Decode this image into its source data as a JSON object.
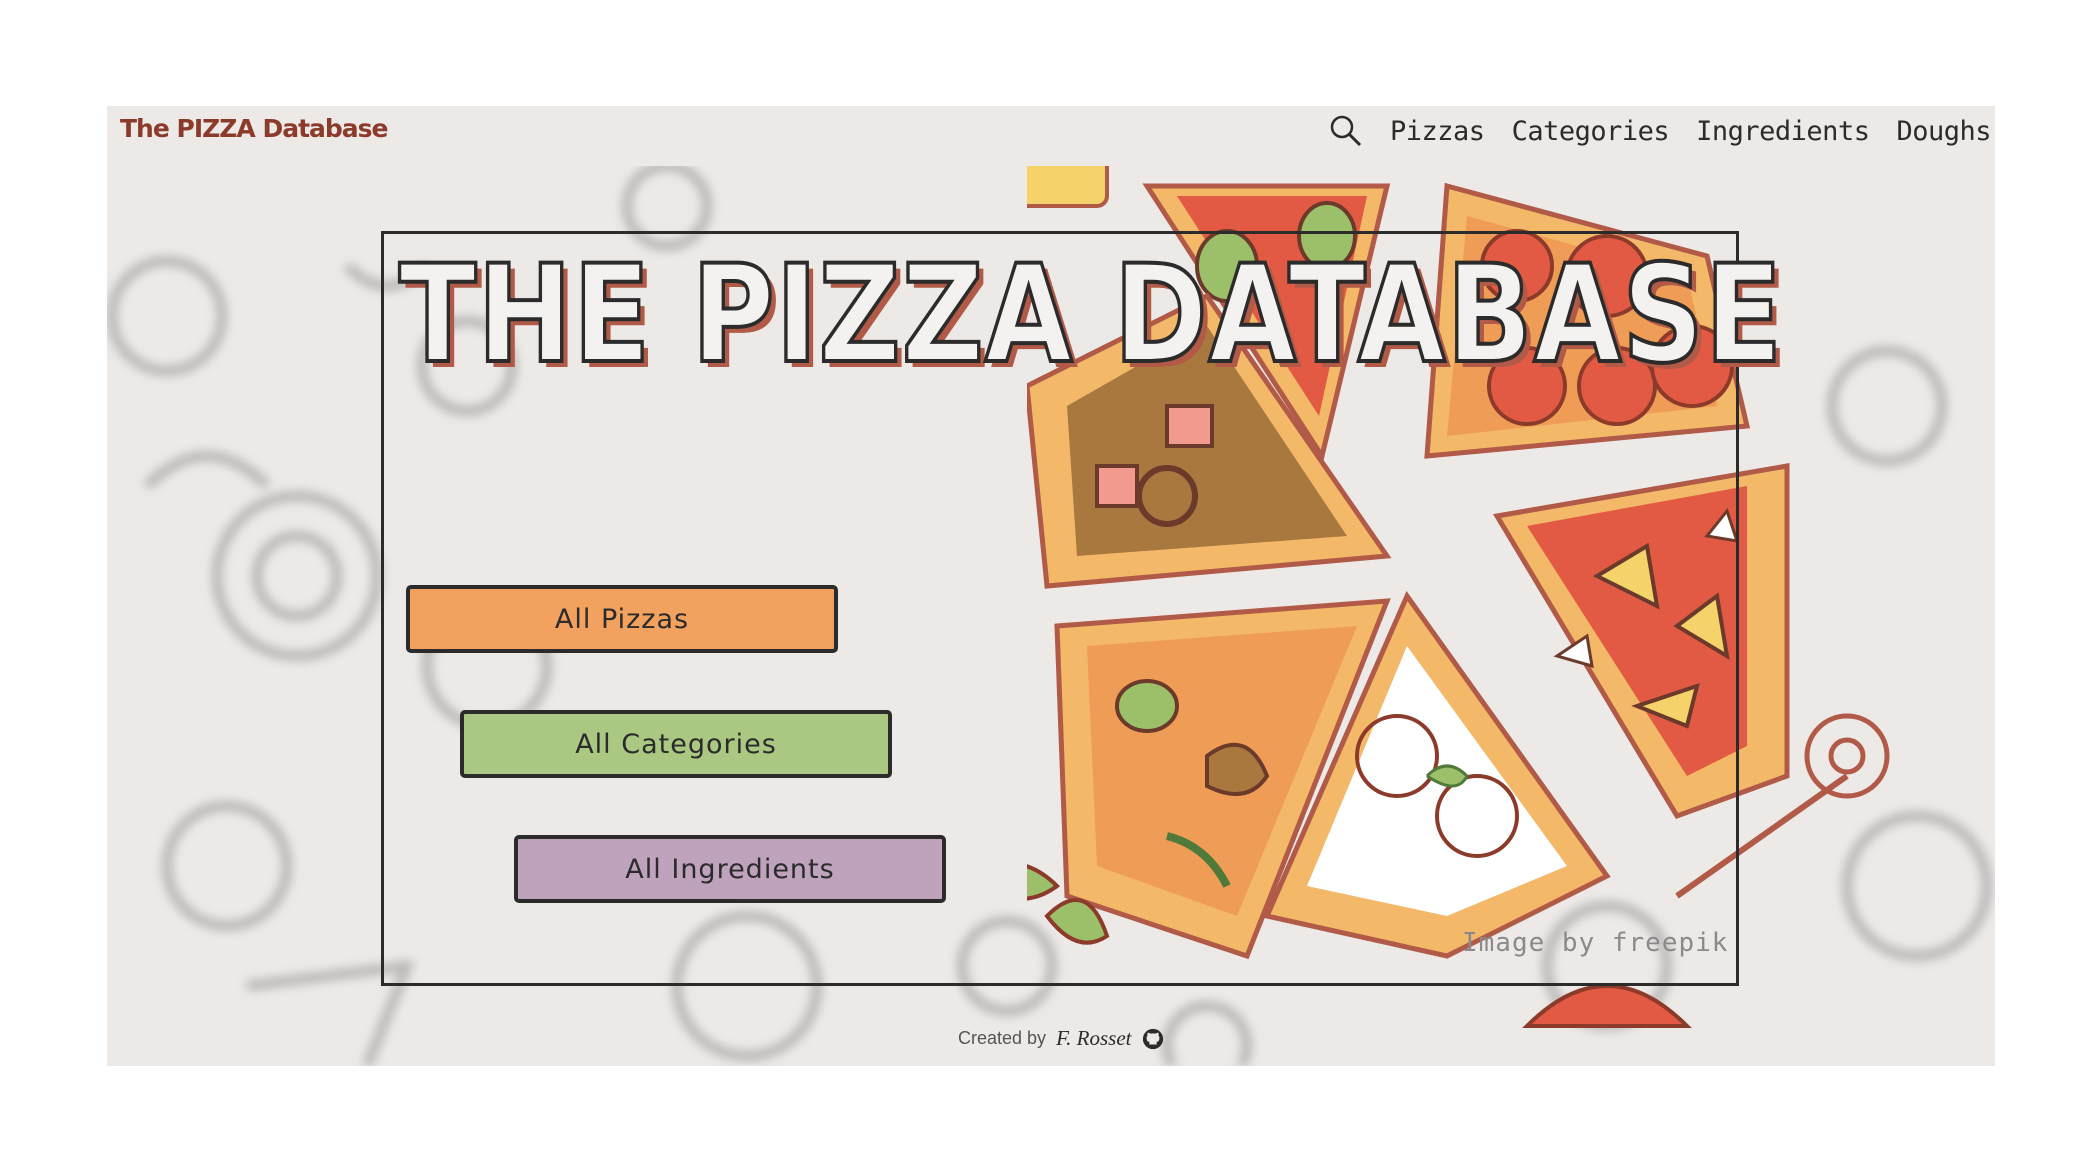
{
  "navbar": {
    "brand": "The PIZZA Database",
    "search_icon": "search-icon",
    "links": [
      "Pizzas",
      "Categories",
      "Ingredients",
      "Doughs"
    ]
  },
  "hero": {
    "title": "THE PIZZA DATABASE",
    "buttons": {
      "pizzas": "All Pizzas",
      "categories": "All Categories",
      "ingredients": "All Ingredients"
    },
    "image_credit": "Image by freepik"
  },
  "footer": {
    "created_by": "Created by",
    "author": "F. Rosset",
    "github_icon": "github-icon"
  },
  "colors": {
    "background": "#ece9e7",
    "brand": "#8c3a2a",
    "pizzas_button": "#f3a15e",
    "categories_button": "#aac882",
    "ingredients_button": "#bfa3bd",
    "title_shadow": "#b05a47"
  }
}
